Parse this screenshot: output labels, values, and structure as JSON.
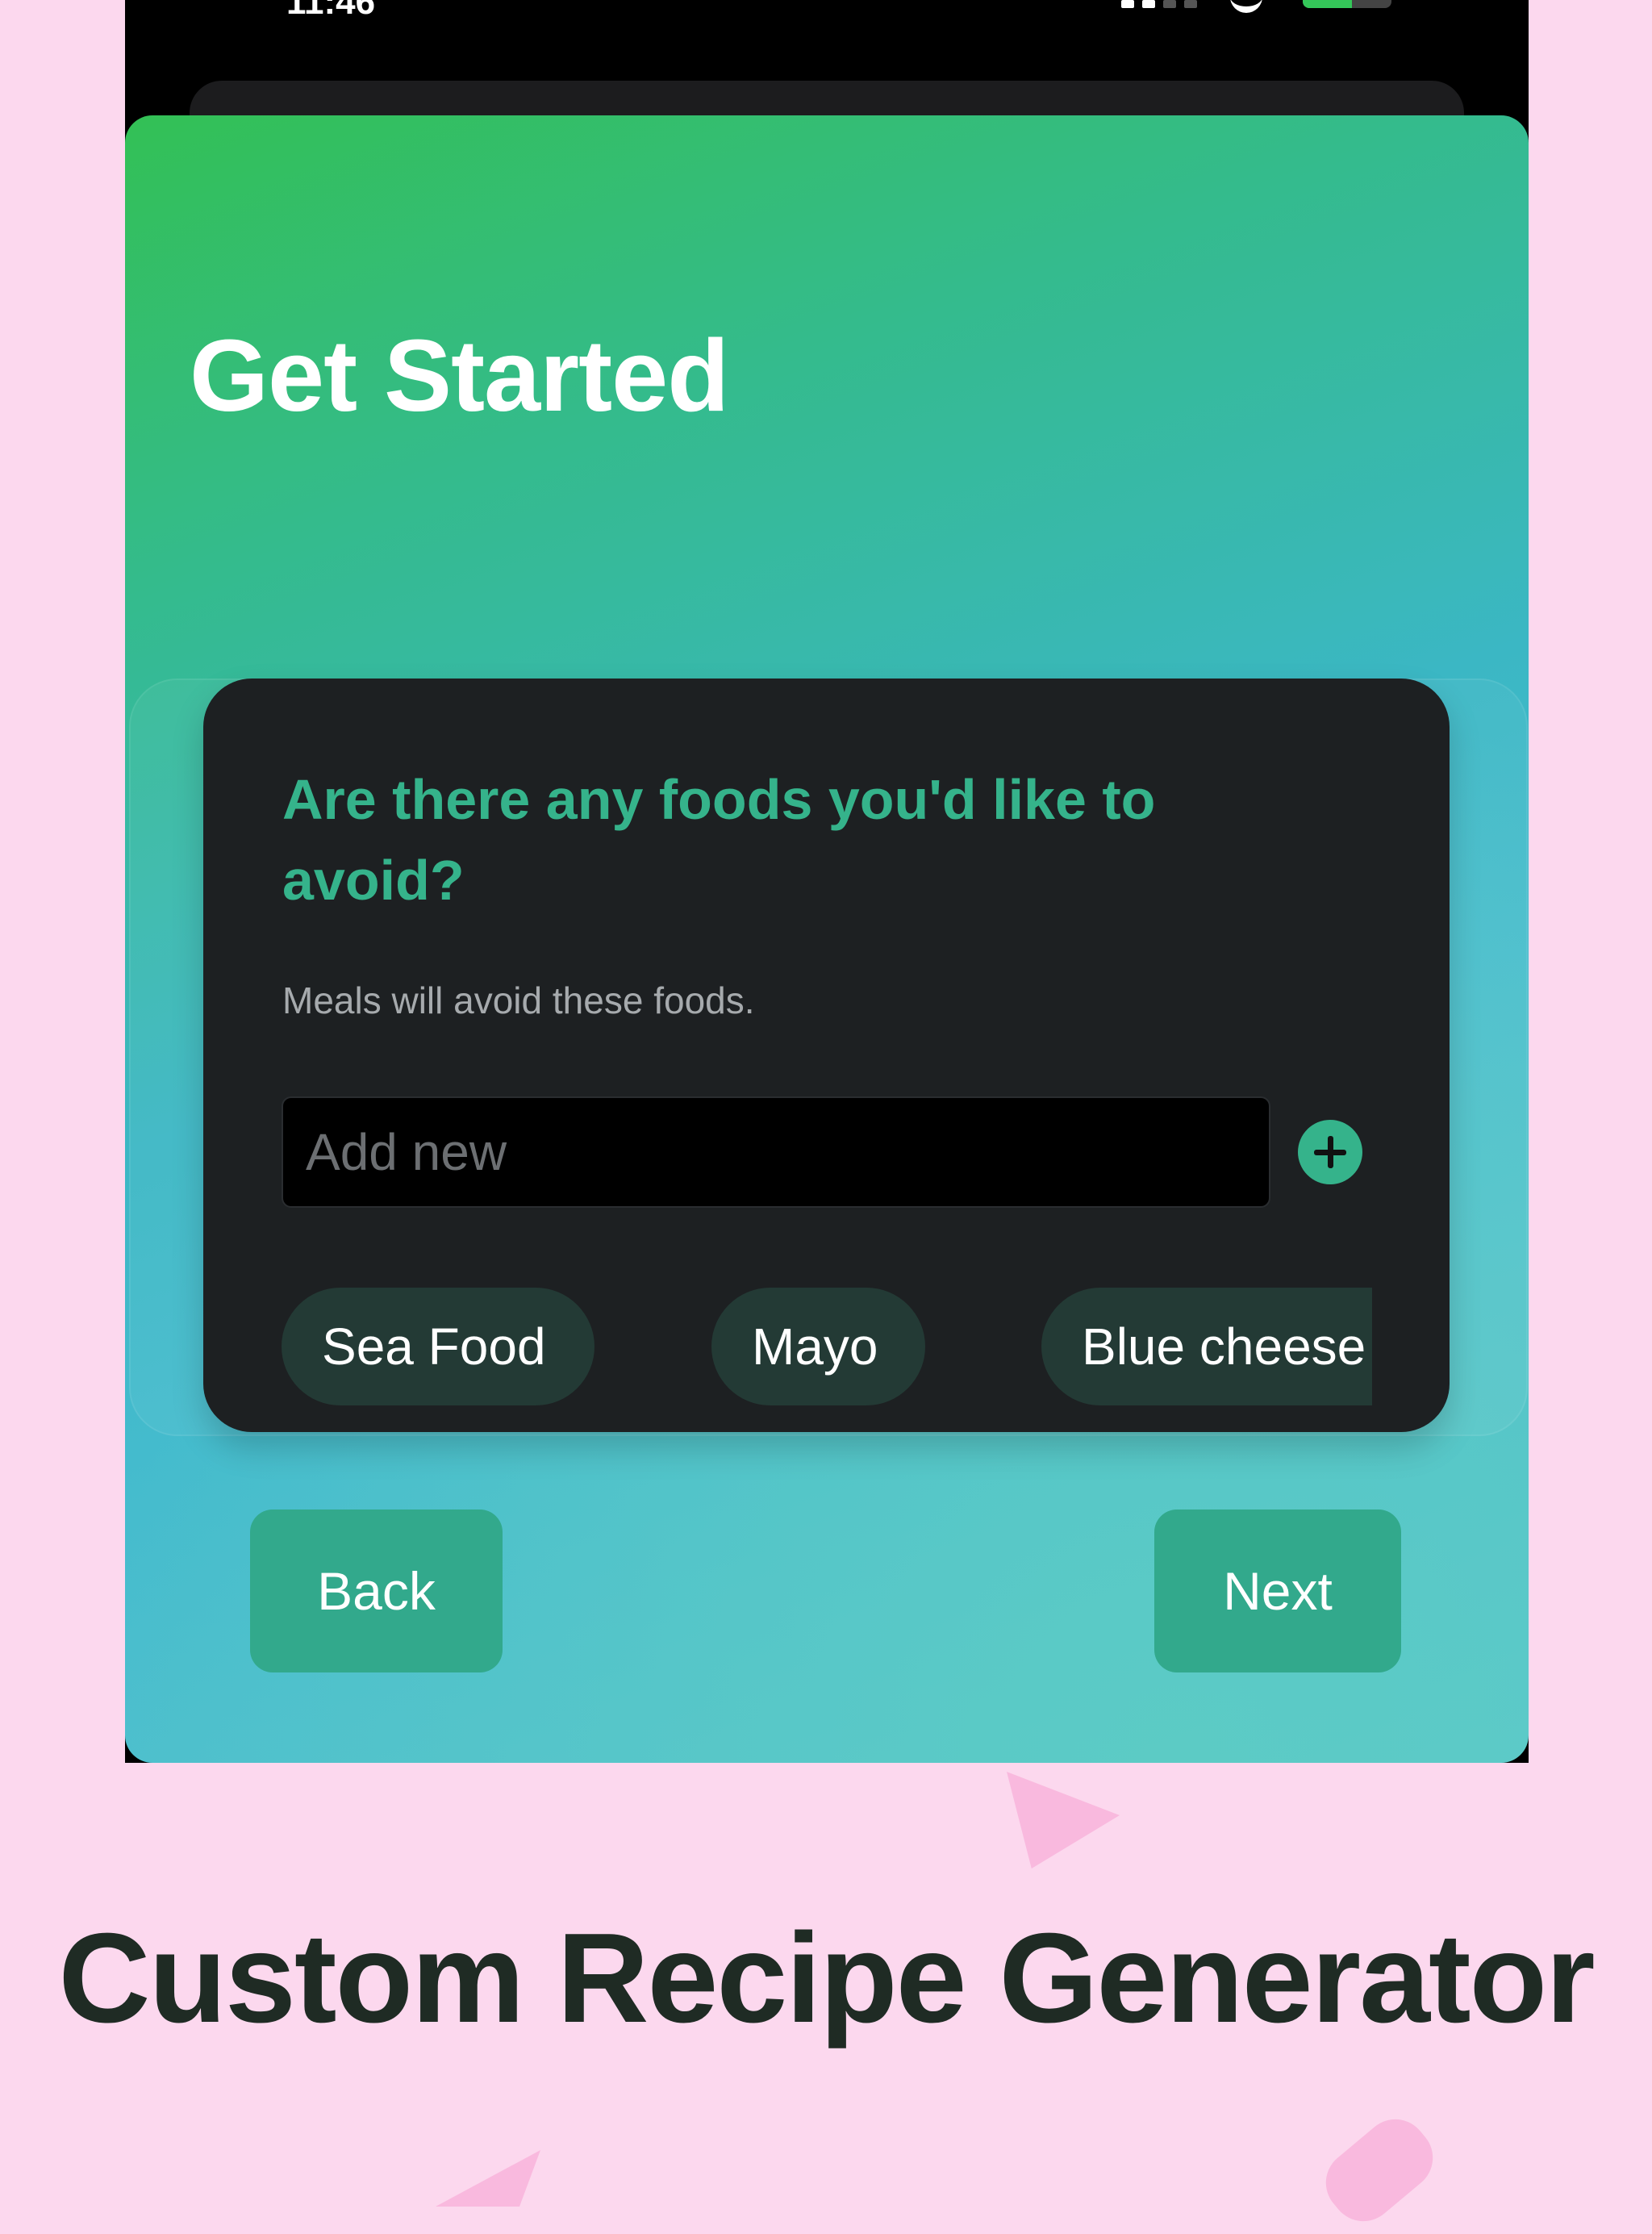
{
  "status_bar": {
    "time": "11:46",
    "battery_level": 0.55
  },
  "onboarding": {
    "title": "Get Started",
    "question": {
      "title": "Are there any foods you'd like to avoid?",
      "subtitle": "Meals will avoid these foods.",
      "input_placeholder": "Add new",
      "input_value": "",
      "avoided_foods": [
        "Sea Food",
        "Mayo",
        "Blue cheese"
      ]
    },
    "buttons": {
      "back": "Back",
      "next": "Next"
    }
  },
  "promo": {
    "caption": "Custom Recipe Generator"
  },
  "colors": {
    "accent": "#35b38b",
    "button": "#32a98c",
    "remove": "#f04a3c",
    "background": "#fcd8ee"
  },
  "icons": {
    "add": "plus-circle-icon",
    "remove": "x-circle-icon"
  }
}
